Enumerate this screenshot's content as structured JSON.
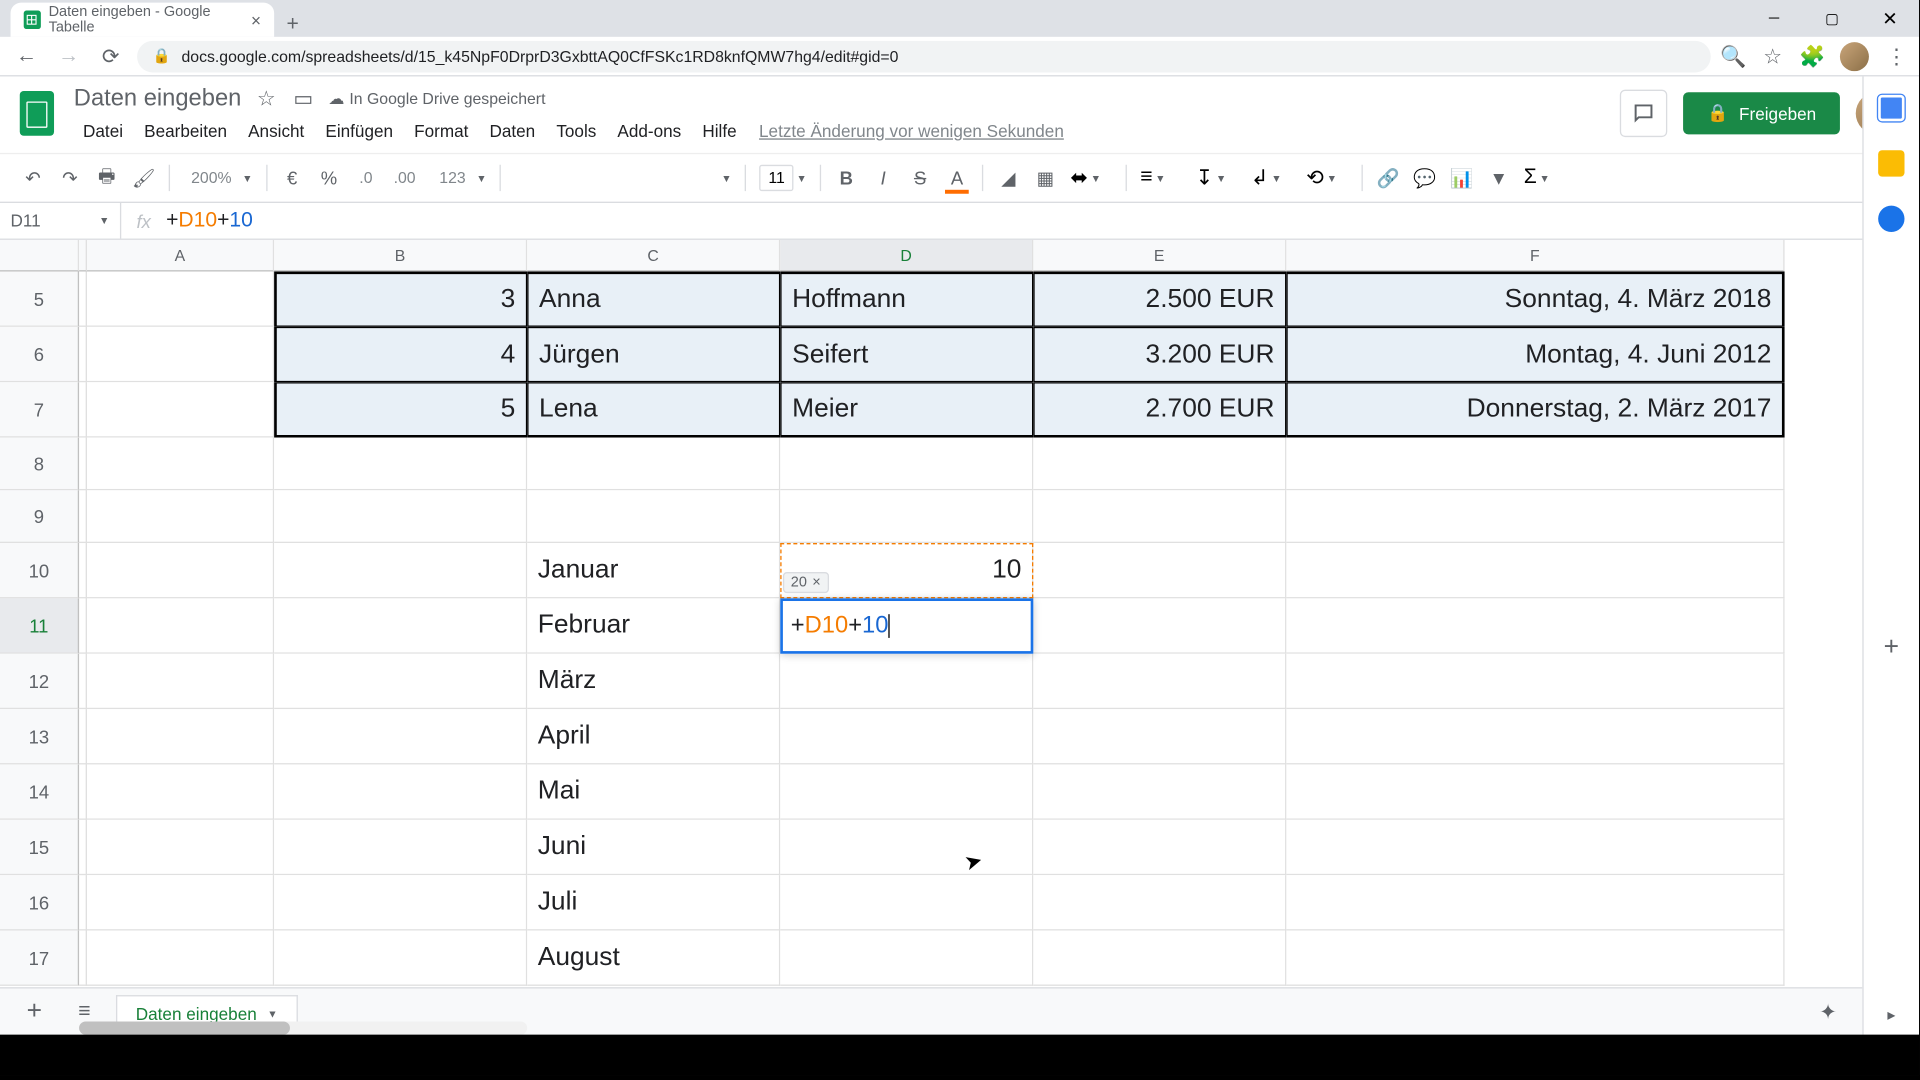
{
  "browser": {
    "tab_title": "Daten eingeben - Google Tabelle",
    "url": "docs.google.com/spreadsheets/d/15_k45NpF0DrprD3GxbttAQ0CfFSKc1RD8knfQMW7hg4/edit#gid=0"
  },
  "doc": {
    "title": "Daten eingeben",
    "save_status": "In Google Drive gespeichert",
    "last_edit": "Letzte Änderung vor wenigen Sekunden",
    "share_label": "Freigeben"
  },
  "menus": {
    "file": "Datei",
    "edit": "Bearbeiten",
    "view": "Ansicht",
    "insert": "Einfügen",
    "format": "Format",
    "data": "Daten",
    "tools": "Tools",
    "addons": "Add-ons",
    "help": "Hilfe"
  },
  "toolbar": {
    "zoom": "200%",
    "currency": "€",
    "percent": "%",
    "dec_less": ".0",
    "dec_more": ".00",
    "num_format": "123",
    "font_size": "11"
  },
  "name_box": "D11",
  "formula": {
    "p1": "+",
    "ref": "D10",
    "p2": "+",
    "num": "10"
  },
  "columns": [
    "A",
    "B",
    "C",
    "D",
    "E",
    "F"
  ],
  "rows": {
    "r5": {
      "n": "5",
      "b": "3",
      "c": "Anna",
      "d": "Hoffmann",
      "e": "2.500 EUR",
      "f": "Sonntag, 4. März 2018"
    },
    "r6": {
      "n": "6",
      "b": "4",
      "c": "Jürgen",
      "d": "Seifert",
      "e": "3.200 EUR",
      "f": "Montag, 4. Juni 2012"
    },
    "r7": {
      "n": "7",
      "b": "5",
      "c": "Lena",
      "d": "Meier",
      "e": "2.700 EUR",
      "f": "Donnerstag, 2. März 2017"
    },
    "r8": {
      "n": "8"
    },
    "r9": {
      "n": "9"
    },
    "r10": {
      "n": "10",
      "c": "Januar",
      "d": "10"
    },
    "r11": {
      "n": "11",
      "c": "Februar"
    },
    "r12": {
      "n": "12",
      "c": "März"
    },
    "r13": {
      "n": "13",
      "c": "April"
    },
    "r14": {
      "n": "14",
      "c": "Mai"
    },
    "r15": {
      "n": "15",
      "c": "Juni"
    },
    "r16": {
      "n": "16",
      "c": "Juli"
    },
    "r17": {
      "n": "17",
      "c": "August"
    }
  },
  "cell_edit": {
    "preview": "20",
    "formula_p1": "+",
    "formula_ref": "D10",
    "formula_p2": "+",
    "formula_num": "10"
  },
  "sheet_tab": "Daten eingeben"
}
